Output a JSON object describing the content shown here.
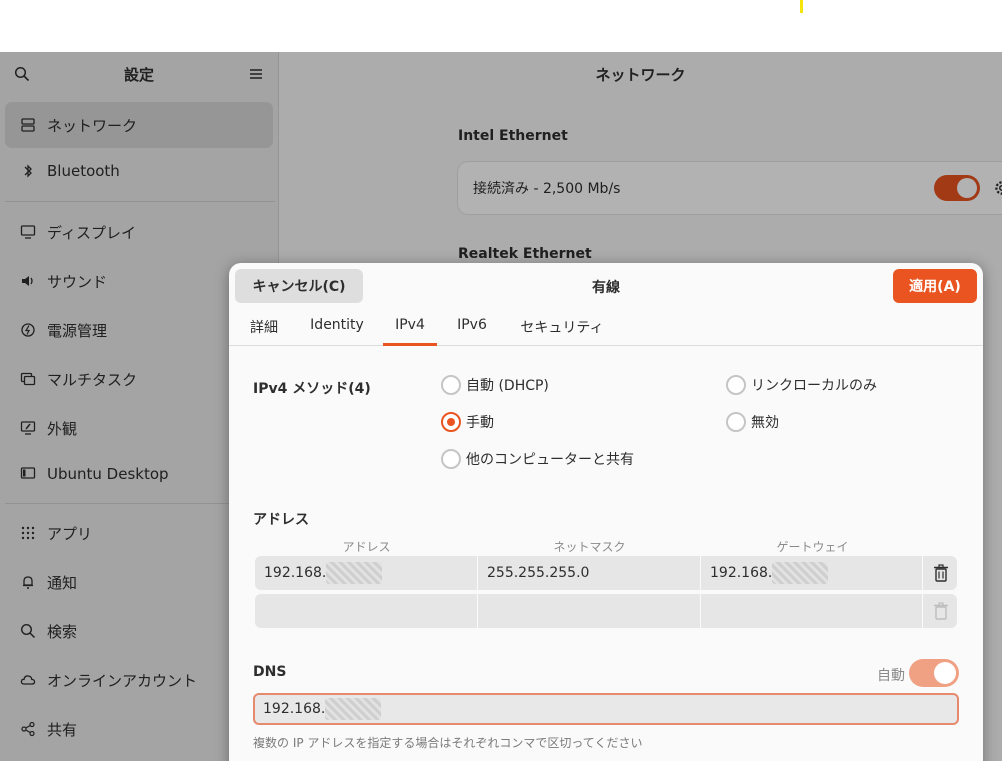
{
  "sidebar": {
    "title": "設定",
    "items": [
      {
        "label": "ネットワーク",
        "icon": "network-icon",
        "selected": true
      },
      {
        "label": "Bluetooth",
        "icon": "bluetooth-icon"
      },
      {
        "label": "ディスプレイ",
        "icon": "display-icon"
      },
      {
        "label": "サウンド",
        "icon": "sound-icon"
      },
      {
        "label": "電源管理",
        "icon": "power-icon"
      },
      {
        "label": "マルチタスク",
        "icon": "multitasking-icon"
      },
      {
        "label": "外観",
        "icon": "appearance-icon"
      },
      {
        "label": "Ubuntu Desktop",
        "icon": "ubuntu-desktop-icon"
      },
      {
        "label": "アプリ",
        "icon": "apps-grid-icon"
      },
      {
        "label": "通知",
        "icon": "bell-icon"
      },
      {
        "label": "検索",
        "icon": "search-icon"
      },
      {
        "label": "オンラインアカウント",
        "icon": "cloud-icon"
      },
      {
        "label": "共有",
        "icon": "share-icon"
      }
    ]
  },
  "main": {
    "title": "ネットワーク",
    "sections": [
      {
        "label": "Intel Ethernet",
        "status": "接続済み - 2,500 Mb/s",
        "enabled": true
      },
      {
        "label": "Realtek Ethernet"
      }
    ]
  },
  "dialog": {
    "cancel_label": "キャンセル(C)",
    "title": "有線",
    "apply_label": "適用(A)",
    "tabs": [
      {
        "label": "詳細"
      },
      {
        "label": "Identity"
      },
      {
        "label": "IPv4",
        "active": true
      },
      {
        "label": "IPv6"
      },
      {
        "label": "セキュリティ"
      }
    ],
    "method_label": "IPv4 メソッド(4)",
    "methods": {
      "dhcp": "自動 (DHCP)",
      "link_local": "リンクローカルのみ",
      "manual": "手動",
      "disabled": "無効",
      "shared": "他のコンピューターと共有"
    },
    "selected_method": "手動",
    "address_label": "アドレス",
    "columns": {
      "address": "アドレス",
      "netmask": "ネットマスク",
      "gateway": "ゲートウェイ"
    },
    "rows": [
      {
        "address": "192.168.",
        "netmask": "255.255.255.0",
        "gateway": "192.168."
      }
    ],
    "dns_label": "DNS",
    "dns_auto_label": "自動",
    "dns_auto": true,
    "dns_value": "192.168.",
    "dns_hint": "複数の IP アドレスを指定する場合はそれぞれコンマで区切ってください"
  }
}
